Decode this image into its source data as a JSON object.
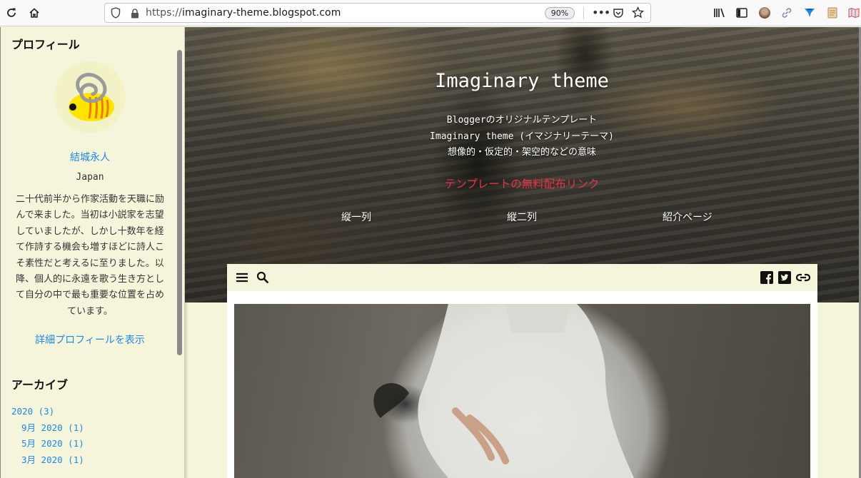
{
  "browser": {
    "url_scheme": "https://",
    "url_host": "imaginary-theme.blogspot.com",
    "zoom": "90%"
  },
  "sidebar": {
    "profile_heading": "プロフィール",
    "name": "結城永人",
    "location": "Japan",
    "bio": "二十代前半から作家活動を天職に励んで来ました。当初は小説家を志望していましたが、しかし十数年を経て作詩する機会も増すほどに詩人こそ素性だと考えるに至りました。以降、個人的に永遠を歌う生き方として自分の中で最も重要な位置を占めています。",
    "profile_link": "詳細プロフィールを表示",
    "archive_heading": "アーカイブ",
    "archive": [
      {
        "label": "2020 (3)",
        "child": false
      },
      {
        "label": "9月 2020 (1)",
        "child": true
      },
      {
        "label": "5月 2020 (1)",
        "child": true
      },
      {
        "label": "3月 2020 (1)",
        "child": true
      }
    ]
  },
  "hero": {
    "title": "Imaginary theme",
    "desc_line1": "Bloggerのオリジナルテンプレート",
    "desc_line2": "Imaginary theme (イマジナリーテーマ)",
    "desc_line3": "想像的・仮定的・架空的などの意味",
    "link": "テンプレートの無料配布リンク",
    "nav": [
      "縦一列",
      "縦二列",
      "紹介ページ"
    ]
  },
  "colors": {
    "background": "#f5f5dc",
    "link_blue": "#1e88e5",
    "hero_link_red": "#e8334a"
  }
}
